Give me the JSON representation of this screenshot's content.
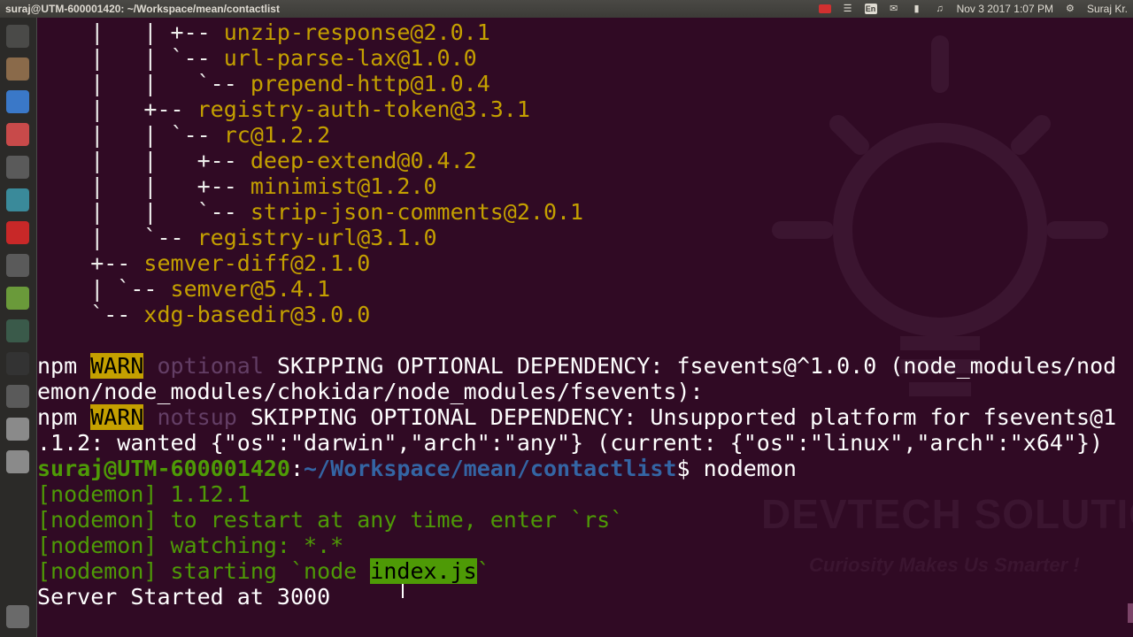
{
  "panel": {
    "title": "suraj@UTM-600001420: ~/Workspace/mean/contactlist",
    "clock": "Nov 3 2017  1:07 PM",
    "user": "Suraj Kr.",
    "kb_label": "En"
  },
  "launcher": {
    "items": [
      {
        "icon": "dash-icon",
        "color": "#4a4a48"
      },
      {
        "icon": "files-icon",
        "color": "#8a6a4a"
      },
      {
        "icon": "chrome-icon",
        "color": "#3a78c8"
      },
      {
        "icon": "settings-icon",
        "color": "#c84a4a"
      },
      {
        "icon": "keyboard-icon",
        "color": "#5a5a5a"
      },
      {
        "icon": "monitor-icon",
        "color": "#3a8a9a"
      },
      {
        "icon": "filezilla-icon",
        "color": "#c82828"
      },
      {
        "icon": "gimp-icon",
        "color": "#5a5a5a"
      },
      {
        "icon": "android-icon",
        "color": "#6a9a3a"
      },
      {
        "icon": "system-monitor-icon",
        "color": "#3a5a4a"
      },
      {
        "icon": "terminal-icon",
        "color": "#333333"
      },
      {
        "icon": "drive-icon",
        "color": "#5a5a5a"
      },
      {
        "icon": "disk-icon",
        "color": "#8a8a8a"
      },
      {
        "icon": "disk2-icon",
        "color": "#8a8a8a"
      },
      {
        "icon": "trash-icon",
        "color": "#6a6a6a"
      }
    ]
  },
  "watermark": {
    "title": "DEVTECH SOLUTIONS",
    "subtitle": "Curiosity Makes Us Smarter !"
  },
  "tree": [
    {
      "prefix": "    |   | +-- ",
      "pkg": "unzip-response@2.0.1"
    },
    {
      "prefix": "    |   | `-- ",
      "pkg": "url-parse-lax@1.0.0"
    },
    {
      "prefix": "    |   |   `-- ",
      "pkg": "prepend-http@1.0.4"
    },
    {
      "prefix": "    |   +-- ",
      "pkg": "registry-auth-token@3.3.1"
    },
    {
      "prefix": "    |   | `-- ",
      "pkg": "rc@1.2.2"
    },
    {
      "prefix": "    |   |   +-- ",
      "pkg": "deep-extend@0.4.2"
    },
    {
      "prefix": "    |   |   +-- ",
      "pkg": "minimist@1.2.0"
    },
    {
      "prefix": "    |   |   `-- ",
      "pkg": "strip-json-comments@2.0.1"
    },
    {
      "prefix": "    |   `-- ",
      "pkg": "registry-url@3.1.0"
    },
    {
      "prefix": "    +-- ",
      "pkg": "semver-diff@2.1.0"
    },
    {
      "prefix": "    | `-- ",
      "pkg": "semver@5.4.1"
    },
    {
      "prefix": "    `-- ",
      "pkg": "xdg-basedir@3.0.0"
    }
  ],
  "warnings": [
    {
      "npm": "npm ",
      "badge": "WARN",
      "kind": " optional ",
      "text": "SKIPPING OPTIONAL DEPENDENCY: fsevents@^1.0.0 (node_modules/nod",
      "cont": "emon/node_modules/chokidar/node_modules/fsevents):"
    },
    {
      "npm": "npm ",
      "badge": "WARN",
      "kind": " notsup ",
      "text": "SKIPPING OPTIONAL DEPENDENCY: Unsupported platform for fsevents@1",
      "cont": ".1.2: wanted {\"os\":\"darwin\",\"arch\":\"any\"} (current: {\"os\":\"linux\",\"arch\":\"x64\"})"
    }
  ],
  "prompt": {
    "user": "suraj@UTM-600001420",
    "sep": ":",
    "path": "~/Workspace/mean/contactlist",
    "symbol": "$ ",
    "command": "nodemon"
  },
  "nodemon": [
    {
      "text": "[nodemon] 1.12.1"
    },
    {
      "text": "[nodemon] to restart at any time, enter `rs`"
    },
    {
      "text": "[nodemon] watching: *.*"
    }
  ],
  "starting": {
    "pre": "[nodemon] starting `node ",
    "highlight": "index.js",
    "post": "`"
  },
  "output": "Server Started at 3000"
}
